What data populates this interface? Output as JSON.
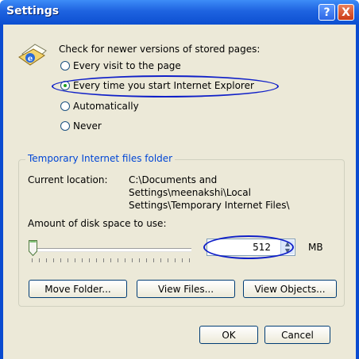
{
  "window": {
    "title": "Settings",
    "help_label": "?",
    "close_label": "X"
  },
  "check": {
    "prompt": "Check for newer versions of stored pages:",
    "options": [
      {
        "label": "Every visit to the page",
        "checked": false
      },
      {
        "label": "Every time you start Internet Explorer",
        "checked": true
      },
      {
        "label": "Automatically",
        "checked": false
      },
      {
        "label": "Never",
        "checked": false
      }
    ]
  },
  "temp": {
    "legend": "Temporary Internet files folder",
    "current_location_label": "Current location:",
    "path_line1": "C:\\Documents and",
    "path_line2": "Settings\\meenakshi\\Local",
    "path_line3": "Settings\\Temporary Internet Files\\",
    "disk_space_label": "Amount of disk space to use:",
    "disk_space_value": "512",
    "unit": "MB",
    "slider_level_fraction": 0.0
  },
  "buttons": {
    "move_folder": "Move Folder...",
    "view_files": "View Files...",
    "view_objects": "View Objects...",
    "ok": "OK",
    "cancel": "Cancel"
  },
  "colors": {
    "title_bar": "#1e63e0",
    "dialog_bg": "#ece9d8",
    "highlight": "#1020c8",
    "legend_text": "#0046d5"
  }
}
